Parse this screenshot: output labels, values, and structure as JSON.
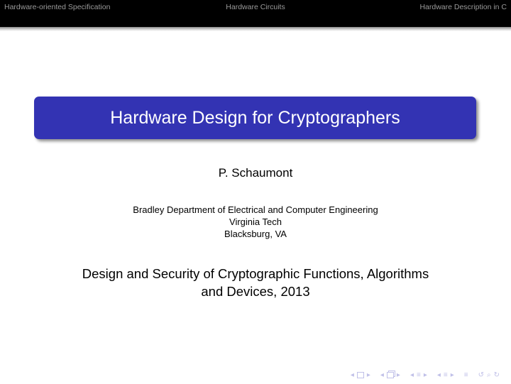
{
  "header": {
    "sections": [
      "Hardware-oriented Specification",
      "Hardware Circuits",
      "Hardware Description in C"
    ]
  },
  "title": "Hardware Design for Cryptographers",
  "author": "P. Schaumont",
  "institute": [
    "Bradley Department of Electrical and Computer Engineering",
    "Virginia Tech",
    "Blacksburg, VA"
  ],
  "date_lines": [
    "Design and Security of Cryptographic Functions, Algorithms",
    "and Devices, 2013"
  ],
  "nav_symbols": {
    "left_arrow": "◂",
    "right_arrow": "▸",
    "align": "≡",
    "search": "⌕",
    "undo": "↺",
    "redo": "↻"
  },
  "colors": {
    "title_bg": "#3333b3",
    "header_bg": "#000000",
    "header_text": "#9a9a9a",
    "nav_symbols": "#c0c0e8"
  }
}
